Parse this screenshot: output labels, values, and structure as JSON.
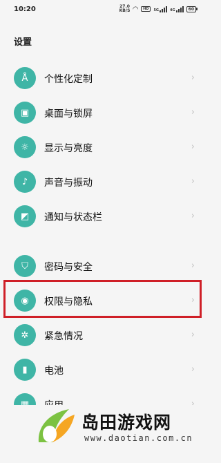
{
  "status_bar": {
    "time": "10:20",
    "net_speed_value": "27.0",
    "net_speed_unit": "KB/S",
    "hd_label": "HD",
    "sig1_label": "5G",
    "sig2_label": "4G",
    "battery_level": "60"
  },
  "page_title": "设置",
  "settings": [
    {
      "label": "个性化定制",
      "icon": "brush-icon",
      "glyph": "Å"
    },
    {
      "label": "桌面与锁屏",
      "icon": "wallpaper-icon",
      "glyph": "▣"
    },
    {
      "label": "显示与亮度",
      "icon": "brightness-icon",
      "glyph": "☼"
    },
    {
      "label": "声音与振动",
      "icon": "bell-icon",
      "glyph": "♪"
    },
    {
      "label": "通知与状态栏",
      "icon": "notification-icon",
      "glyph": "◩"
    },
    {
      "label": "密码与安全",
      "icon": "shield-icon",
      "glyph": "⛉"
    },
    {
      "label": "权限与隐私",
      "icon": "privacy-eye-icon",
      "glyph": "◉"
    },
    {
      "label": "紧急情况",
      "icon": "emergency-icon",
      "glyph": "✲"
    },
    {
      "label": "电池",
      "icon": "battery-icon",
      "glyph": "▮"
    },
    {
      "label": "应用",
      "icon": "apps-grid-icon",
      "glyph": "▦"
    },
    {
      "label": "",
      "icon": "more-icon",
      "glyph": "⚙"
    }
  ],
  "chevron": "›",
  "watermark": {
    "title": "岛田游戏网",
    "url": "www.daotian.com.cn"
  },
  "colors": {
    "icon_bg": "#3fb5a6",
    "highlight": "#cf1f27",
    "background": "#f5f5f5"
  }
}
